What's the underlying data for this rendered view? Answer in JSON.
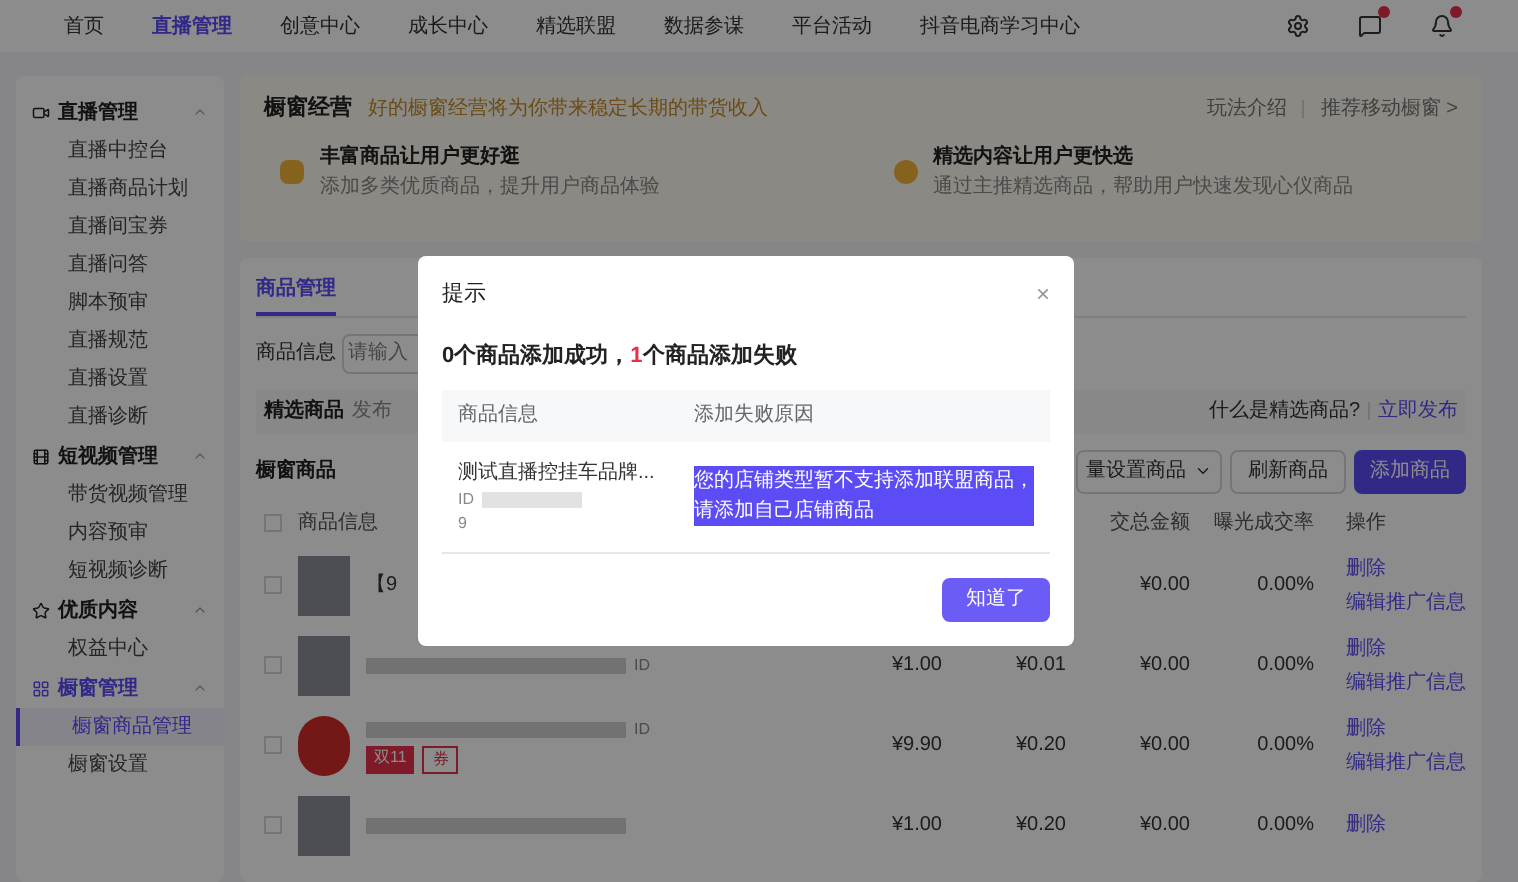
{
  "nav": {
    "items": [
      {
        "label": "首页",
        "selected": false
      },
      {
        "label": "直播管理",
        "selected": true
      },
      {
        "label": "创意中心",
        "selected": false
      },
      {
        "label": "成长中心",
        "selected": false
      },
      {
        "label": "精选联盟",
        "selected": false
      },
      {
        "label": "数据参谋",
        "selected": false
      },
      {
        "label": "平台活动",
        "selected": false
      },
      {
        "label": "抖音电商学习中心",
        "selected": false
      }
    ]
  },
  "sidebar": {
    "groups": [
      {
        "label": "直播管理",
        "expanded": true,
        "active": false,
        "children": [
          {
            "label": "直播中控台",
            "selected": false
          },
          {
            "label": "直播商品计划",
            "selected": false
          },
          {
            "label": "直播间宝券",
            "selected": false
          },
          {
            "label": "直播问答",
            "selected": false
          },
          {
            "label": "脚本预审",
            "selected": false
          },
          {
            "label": "直播规范",
            "selected": false
          },
          {
            "label": "直播设置",
            "selected": false
          },
          {
            "label": "直播诊断",
            "selected": false
          }
        ]
      },
      {
        "label": "短视频管理",
        "expanded": true,
        "active": false,
        "children": [
          {
            "label": "带货视频管理",
            "selected": false
          },
          {
            "label": "内容预审",
            "selected": false
          },
          {
            "label": "短视频诊断",
            "selected": false
          }
        ]
      },
      {
        "label": "优质内容",
        "expanded": true,
        "active": false,
        "children": [
          {
            "label": "权益中心",
            "selected": false
          }
        ]
      },
      {
        "label": "橱窗管理",
        "expanded": true,
        "active": true,
        "children": [
          {
            "label": "橱窗商品管理",
            "selected": true
          },
          {
            "label": "橱窗设置",
            "selected": false
          }
        ]
      }
    ]
  },
  "intro": {
    "title": "橱窗经营",
    "subtitle": "好的橱窗经营将为你带来稳定长期的带货收入",
    "links": [
      "玩法介绍",
      "推荐移动橱窗 >"
    ],
    "features": [
      {
        "title": "丰富商品让用户更好逛",
        "desc": "添加多类优质商品，提升用户商品体验"
      },
      {
        "title": "精选内容让用户更快选",
        "desc": "通过主推精选商品，帮助用户快速发现心仪商品"
      }
    ]
  },
  "manage": {
    "tab": "商品管理",
    "filter_label": "商品信息",
    "filter_placeholder": "请输入",
    "featured": {
      "label": "精选商品",
      "desc": "发布",
      "question": "什么是精选商品?",
      "link": "立即发布"
    },
    "heading": "橱窗商品",
    "select_all_checked": false,
    "buttons": [
      {
        "label": "量设置商品",
        "kind": "dropdown"
      },
      {
        "label": "刷新商品",
        "kind": "plain"
      },
      {
        "label": "添加商品",
        "kind": "primary"
      }
    ],
    "columns": [
      "商品信息",
      "交总金额",
      "曝光成交率",
      "操作"
    ],
    "rows": [
      {
        "checked": false,
        "name": "【9",
        "tags": [],
        "price_1": "",
        "price_2": "",
        "total": "¥0.00",
        "rate": "0.00%",
        "links": [
          "删除",
          "编辑推广信息"
        ]
      },
      {
        "checked": false,
        "name": "",
        "id_label": "ID",
        "tags": [],
        "price_1": "¥1.00",
        "price_2": "¥0.01",
        "total": "¥0.00",
        "rate": "0.00%",
        "links": [
          "删除",
          "编辑推广信息"
        ]
      },
      {
        "checked": false,
        "name": "",
        "id_label": "ID",
        "tags": [
          "双11",
          "券"
        ],
        "price_1": "¥9.90",
        "price_2": "¥0.20",
        "total": "¥0.00",
        "rate": "0.00%",
        "links": [
          "删除",
          "编辑推广信息"
        ]
      },
      {
        "checked": false,
        "name": "",
        "tags": [],
        "price_1": "¥1.00",
        "price_2": "¥0.20",
        "total": "¥0.00",
        "rate": "0.00%",
        "links": [
          "删除"
        ]
      }
    ]
  },
  "dialog": {
    "title": "提示",
    "close": "×",
    "success_text": "0个商品添加成功，",
    "fail_count": "1",
    "fail_text": "个商品添加失败",
    "columns": [
      "商品信息",
      "添加失败原因"
    ],
    "rows": [
      {
        "name": "测试直播控挂车品牌...",
        "id_prefix": "ID",
        "id_tail": "9",
        "reason": "您的店铺类型暂不支持添加联盟商品，请添加自己店铺商品",
        "reason_selected": true
      }
    ],
    "button": "知道了"
  }
}
